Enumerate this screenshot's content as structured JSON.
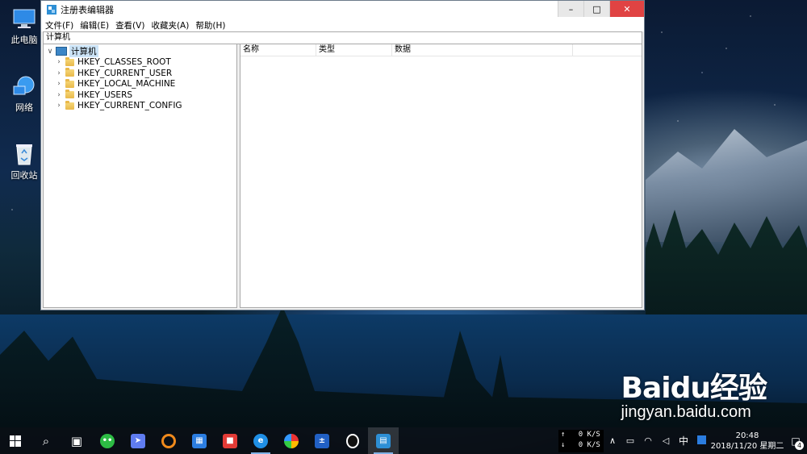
{
  "desktop": {
    "icons": [
      {
        "label": "此电脑",
        "icon": "this-pc-icon"
      },
      {
        "label": "网络",
        "icon": "network-icon"
      },
      {
        "label": "回收站",
        "icon": "recycle-bin-icon"
      }
    ]
  },
  "window": {
    "title": "注册表编辑器",
    "menu": [
      "文件(F)",
      "编辑(E)",
      "查看(V)",
      "收藏夹(A)",
      "帮助(H)"
    ],
    "address": "计算机",
    "tree": {
      "root": "计算机",
      "items": [
        "HKEY_CLASSES_ROOT",
        "HKEY_CURRENT_USER",
        "HKEY_LOCAL_MACHINE",
        "HKEY_USERS",
        "HKEY_CURRENT_CONFIG"
      ]
    },
    "columns": [
      "名称",
      "类型",
      "数据"
    ]
  },
  "taskbar": {
    "net_up": "0 K/S",
    "net_down": "0 K/S",
    "ime": "中",
    "time": "20:48",
    "date": "2018/11/20 星期二",
    "notification_count": "4"
  },
  "watermark": {
    "brand": "Baidu经验",
    "url": "jingyan.baidu.com"
  }
}
